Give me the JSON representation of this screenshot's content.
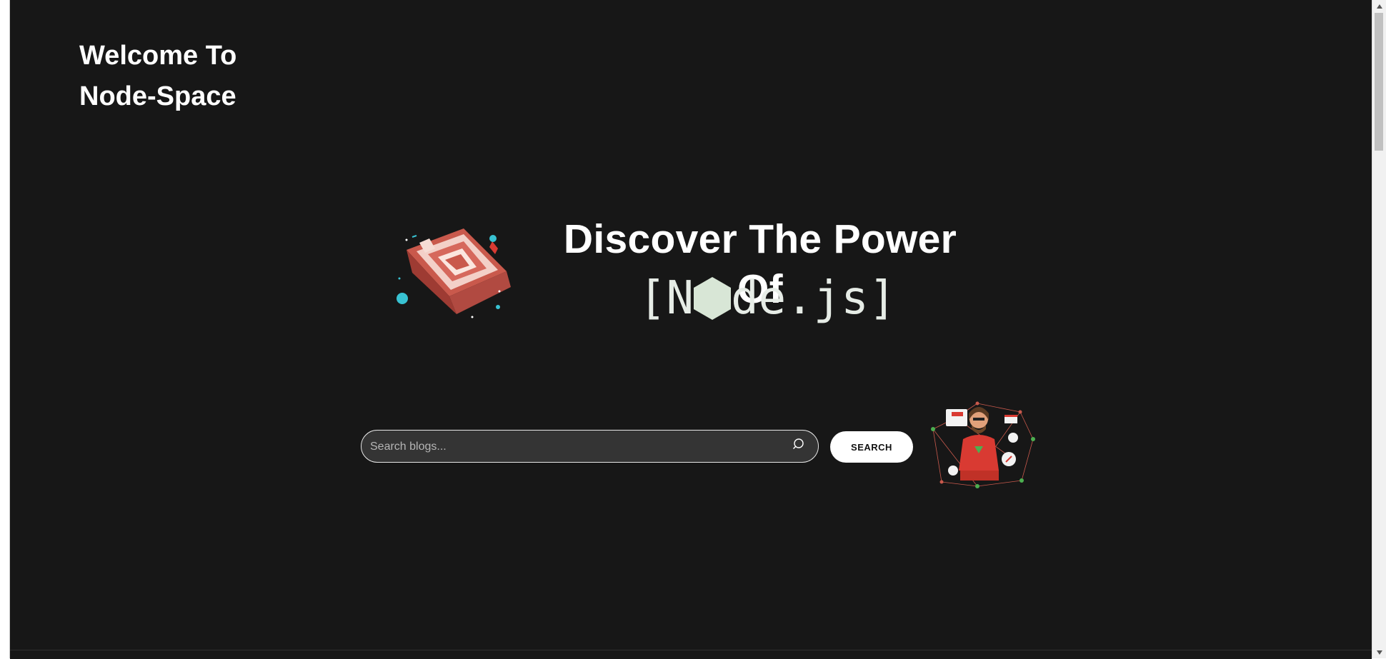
{
  "header": {
    "welcome_line1": "Welcome To",
    "welcome_line2": "Node-Space"
  },
  "hero": {
    "title": "Discover The Power Of",
    "brand_prefix": "[N",
    "brand_suffix": "de.js]"
  },
  "search": {
    "placeholder": "Search blogs...",
    "value": "",
    "button_label": "SEARCH"
  },
  "icons": {
    "search": "search-icon",
    "cube": "cube-illustration",
    "hexagon": "node-hexagon-icon",
    "developer": "developer-illustration",
    "scroll_up": "scroll-up-arrow-icon",
    "scroll_down": "scroll-down-arrow-icon"
  },
  "colors": {
    "background": "#171717",
    "text": "#ffffff",
    "brand_mono": "#e6ece6",
    "search_bg": "#343434",
    "button_bg": "#ffffff",
    "cube_accent": "#d6685c"
  }
}
